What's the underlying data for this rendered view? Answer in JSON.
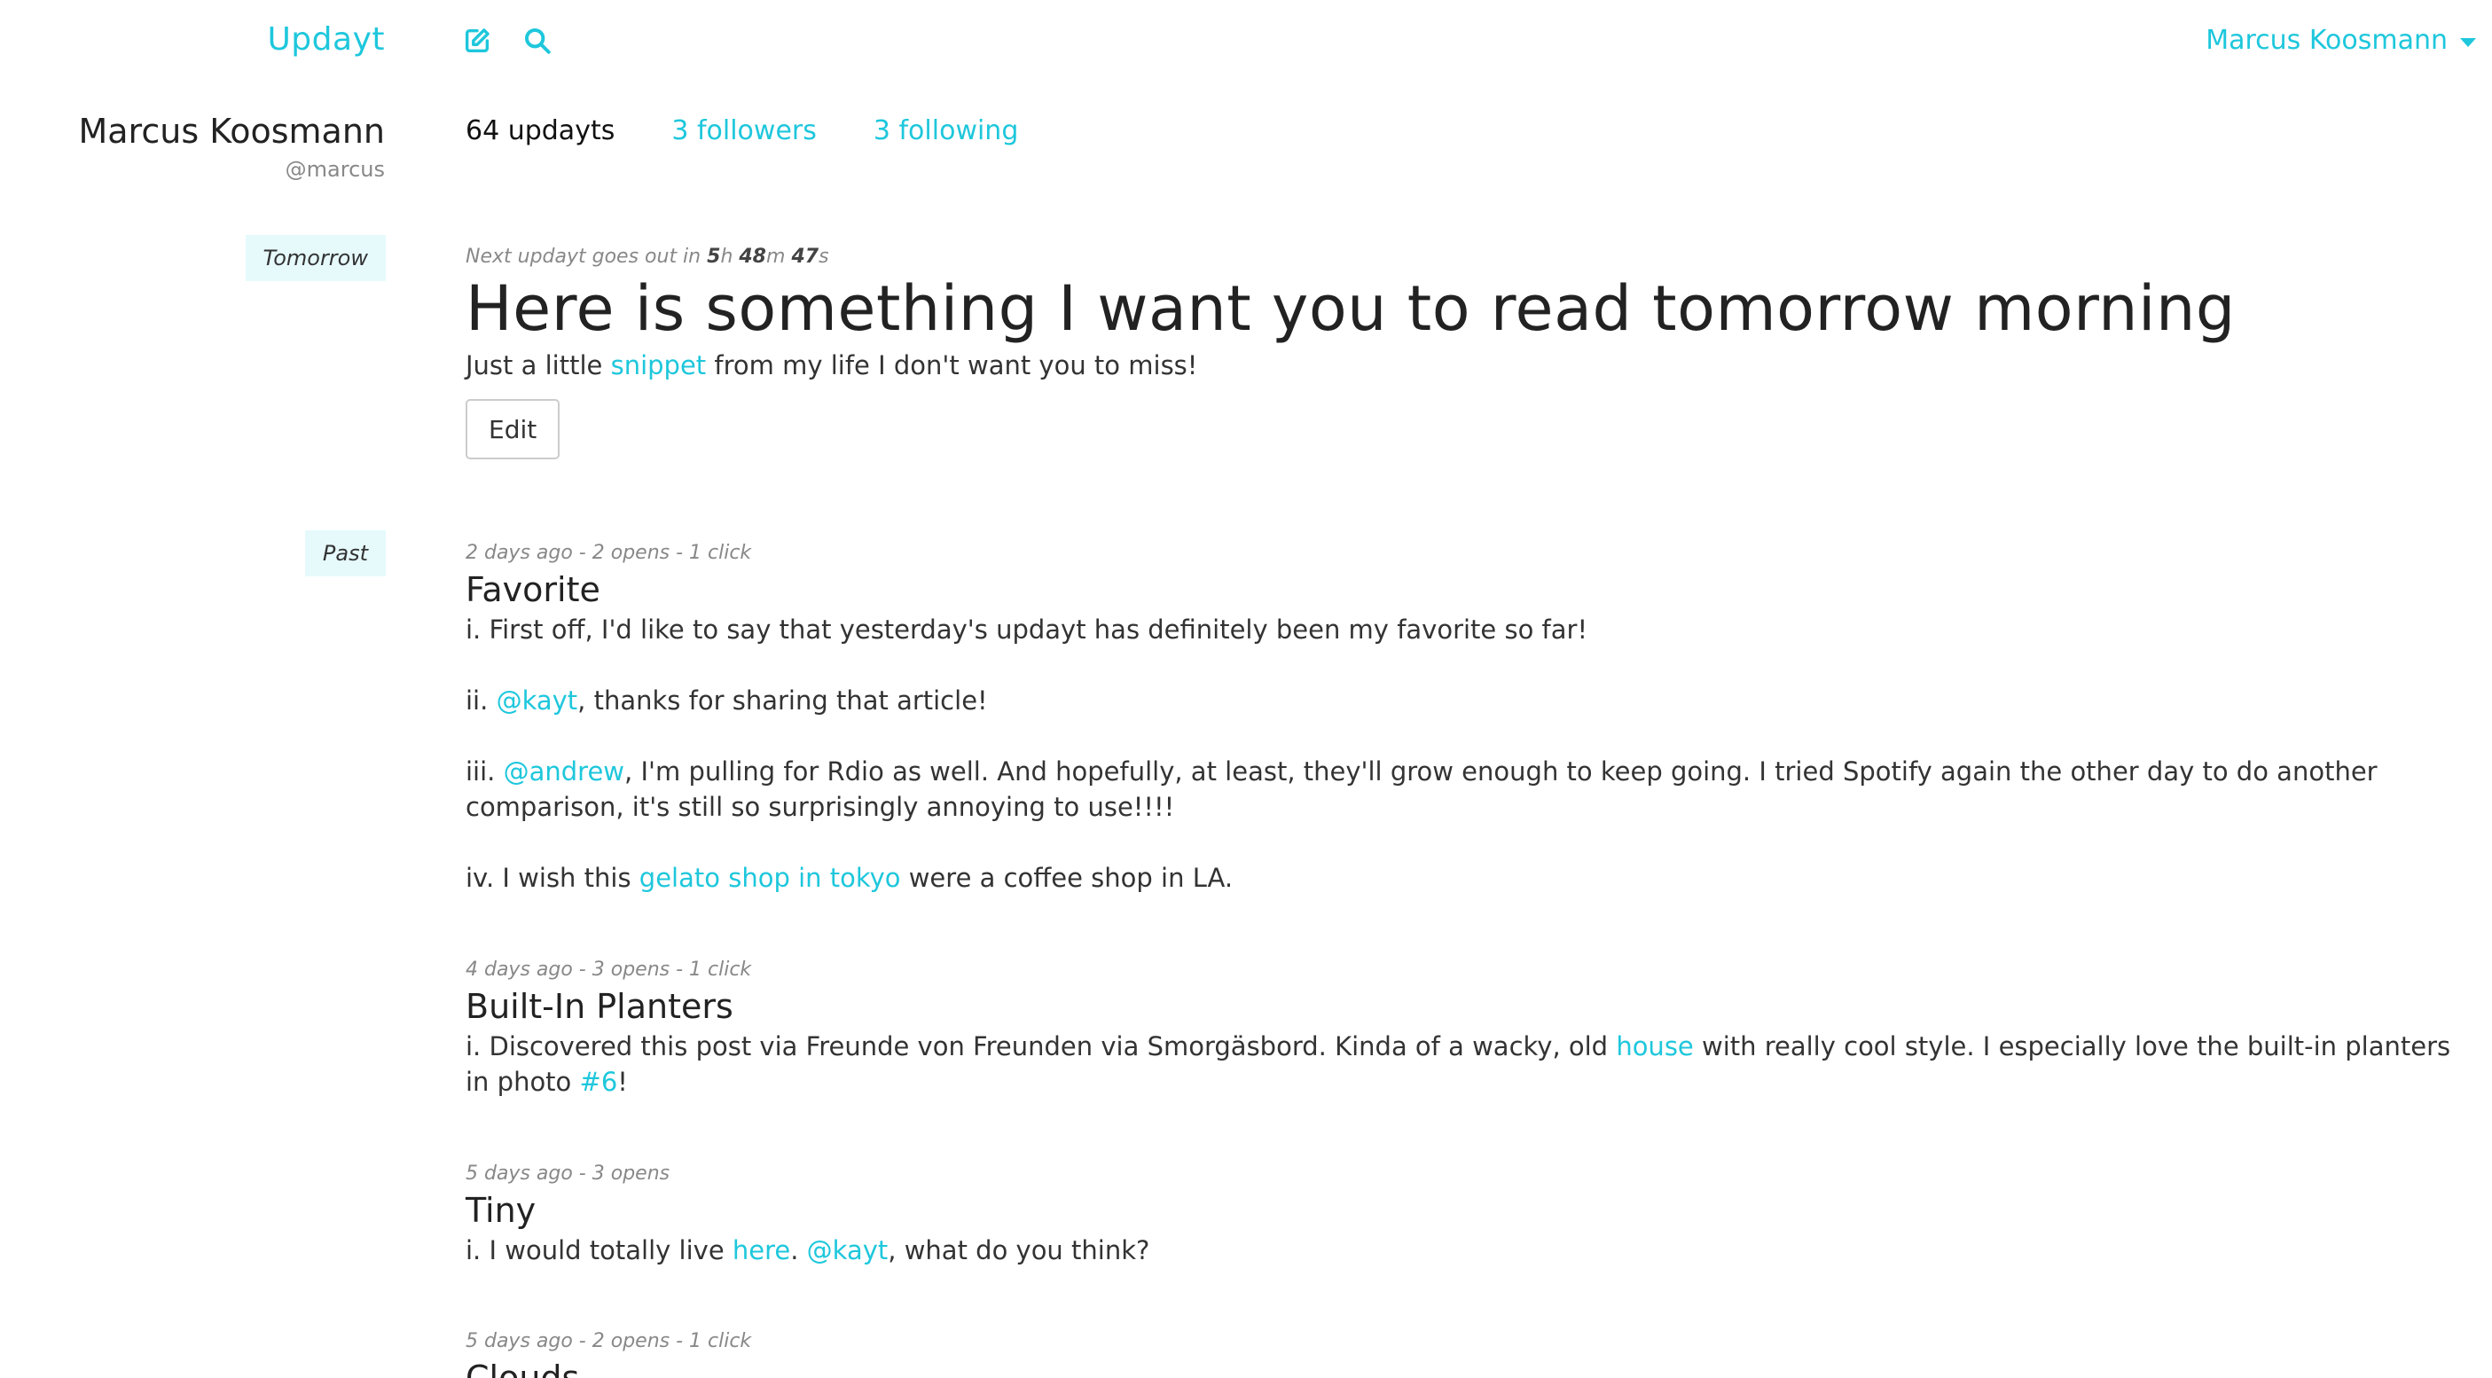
{
  "nav": {
    "brand": "Updayt",
    "compose_icon": "compose-icon",
    "search_icon": "search-icon",
    "user_name": "Marcus Koosmann",
    "accent_color": "#1ec7dc"
  },
  "profile": {
    "name": "Marcus Koosmann",
    "handle": "@marcus",
    "updayts": "64 updayts",
    "followers": "3 followers",
    "following": "3 following"
  },
  "sections": {
    "tomorrow": "Tomorrow",
    "past": "Past"
  },
  "upcoming": {
    "countdown_prefix": "Next updayt goes out in ",
    "hours": "5",
    "hours_unit": "h ",
    "minutes": "48",
    "minutes_unit": "m ",
    "seconds": "47",
    "seconds_unit": "s",
    "title": "Here is something I want you to read tomorrow morning",
    "body_before": "Just a little ",
    "body_link": "snippet",
    "body_after": " from my life I don't want you to miss!",
    "edit_label": "Edit"
  },
  "posts": [
    {
      "meta": "2 days ago - 2 opens - 1 click",
      "title": "Favorite",
      "p1": "i. First off, I'd like to say that yesterday's updayt has definitely been my favorite so far!",
      "p2_before": "ii. ",
      "p2_link": "@kayt",
      "p2_after": ", thanks for sharing that article!",
      "p3_before": "iii. ",
      "p3_link": "@andrew",
      "p3_after": ", I'm pulling for Rdio as well. And hopefully, at least, they'll grow enough to keep going. I tried Spotify again the other day to do another comparison, it's still so surprisingly annoying to use!!!!",
      "p4_before": "iv. I wish this ",
      "p4_link": "gelato shop in tokyo",
      "p4_after": " were a coffee shop in LA."
    },
    {
      "meta": "4 days ago - 3 opens - 1 click",
      "title": "Built-In Planters",
      "p1_before": "i. Discovered this post via Freunde von Freunden via Smorgäsbord. Kinda of a wacky, old ",
      "p1_link": "house",
      "p1_mid": " with really cool style. I especially love the built-in planters in photo ",
      "p1_link2": "#6",
      "p1_after": "!"
    },
    {
      "meta": "5 days ago - 3 opens",
      "title": "Tiny",
      "p1_before": "i. I would totally live ",
      "p1_link": "here",
      "p1_mid": ". ",
      "p1_link2": "@kayt",
      "p1_after": ", what do you think?"
    },
    {
      "meta": "5 days ago - 2 opens - 1 click",
      "title": "Clouds..."
    }
  ]
}
